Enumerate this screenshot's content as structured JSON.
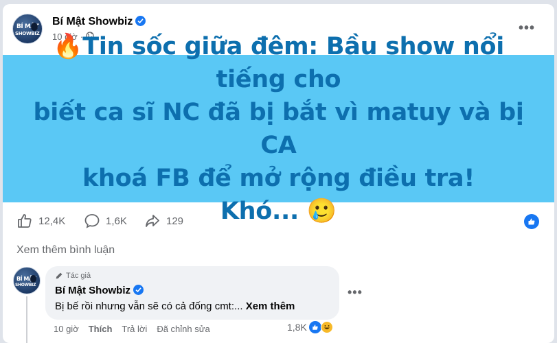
{
  "post": {
    "page_name": "Bí Mật Showbiz",
    "time": "10 giờ",
    "separator": "·",
    "avatar_text_top": "BÍ MẬT",
    "avatar_text_bottom": "SHOWBIZ",
    "banner": {
      "line1": "🔥Tin sốc giữa đêm: Bầu show nổi tiếng cho",
      "line2": "biết ca sĩ NC đã bị bắt vì matuy và bị CA",
      "line3": "khoá FB để mở rộng điều tra!",
      "line4": "Khó... 🥲",
      "background": "#5ac8f5",
      "text_color": "#0d6fae"
    },
    "reactions_count": "12,4K",
    "comments_count": "1,6K",
    "shares_count": "129"
  },
  "view_more_comments": "Xem thêm bình luận",
  "comment": {
    "author_tag": "Tác giả",
    "name": "Bí Mật Showbiz",
    "text": "Bị bế rồi nhưng vẫn sẽ có cả đống cmt:... ",
    "see_more": "Xem thêm",
    "time": "10 giờ",
    "like_label": "Thích",
    "reply_label": "Trả lời",
    "edited_label": "Đã chỉnh sửa",
    "reaction_count": "1,8K"
  },
  "colors": {
    "accent": "#1877f2",
    "muted": "#65676b"
  }
}
